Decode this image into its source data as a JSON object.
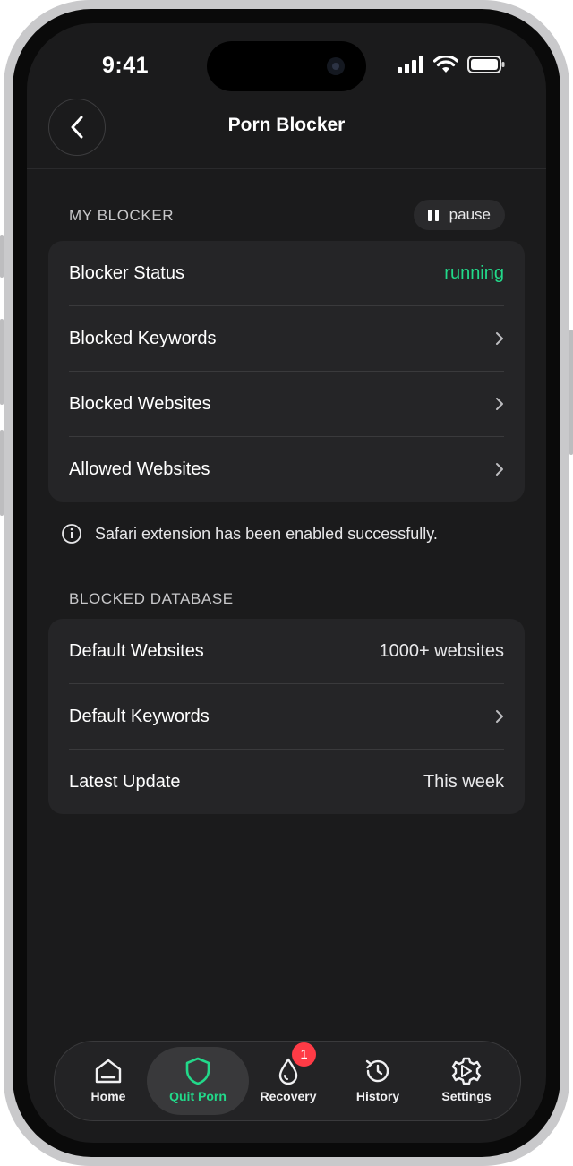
{
  "status_bar": {
    "time": "9:41"
  },
  "header": {
    "title": "Porn Blocker"
  },
  "my_blocker": {
    "section_label": "MY BLOCKER",
    "pause_label": "pause",
    "rows": [
      {
        "label": "Blocker Status",
        "value": "running"
      },
      {
        "label": "Blocked Keywords"
      },
      {
        "label": "Blocked Websites"
      },
      {
        "label": "Allowed Websites"
      }
    ]
  },
  "info_message": "Safari extension has been enabled successfully.",
  "blocked_database": {
    "section_label": "BLOCKED DATABASE",
    "rows": [
      {
        "label": "Default Websites",
        "value": "1000+ websites"
      },
      {
        "label": "Default Keywords"
      },
      {
        "label": "Latest Update",
        "value": "This week"
      }
    ]
  },
  "tabbar": {
    "tabs": [
      {
        "label": "Home",
        "icon": "home-icon"
      },
      {
        "label": "Quit Porn",
        "icon": "shield-icon",
        "active": true
      },
      {
        "label": "Recovery",
        "icon": "droplet-icon",
        "badge": "1"
      },
      {
        "label": "History",
        "icon": "history-icon"
      },
      {
        "label": "Settings",
        "icon": "gear-icon"
      }
    ]
  },
  "colors": {
    "accent_green": "#22d98a",
    "badge_red": "#ff3b46",
    "background": "#1b1b1c",
    "card": "#252527"
  }
}
